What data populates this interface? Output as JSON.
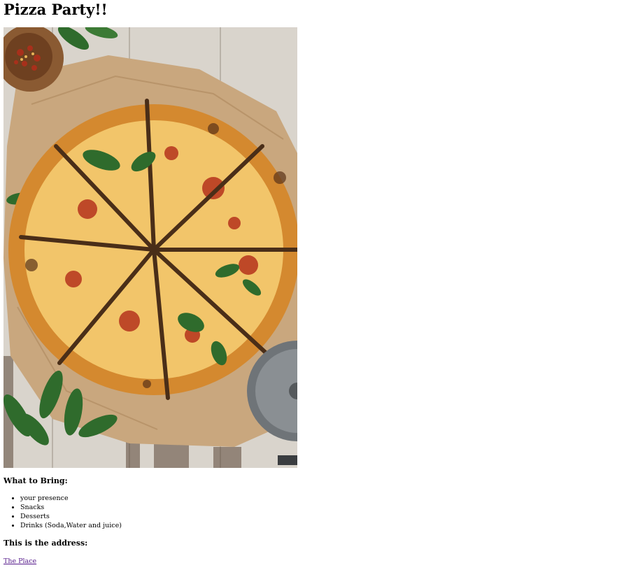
{
  "page": {
    "title": "Pizza Party!!"
  },
  "image": {
    "subject": "pizza-photo",
    "colors": {
      "table": "#d9d4cc",
      "parchment": "#c9a77e",
      "crust": "#d4892f",
      "cheese": "#f2c56a",
      "sauce": "#b5331c",
      "basil": "#2f6b2c",
      "bowl": "#8a5a32",
      "cutter": "#6f7478"
    }
  },
  "bring": {
    "heading": "What to Bring:",
    "items": [
      "your presence",
      "Snacks",
      "Desserts",
      "Drinks (Soda,Water and juice)"
    ]
  },
  "address": {
    "heading": "This is the address:",
    "link_label": "The Place",
    "link_color": "#551a8b"
  }
}
